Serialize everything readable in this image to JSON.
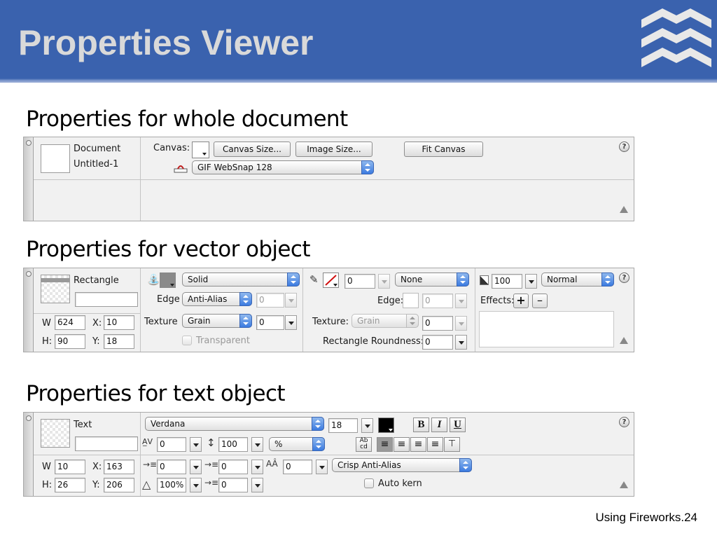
{
  "header": {
    "title": "Properties Viewer"
  },
  "sections": {
    "document": "Properties for whole document",
    "vector": "Properties for vector object",
    "text": "Properties for text object"
  },
  "doc_panel": {
    "type_label": "Document",
    "name": "Untitled-1",
    "canvas_label": "Canvas:",
    "canvas_size_btn": "Canvas Size...",
    "image_size_btn": "Image Size...",
    "fit_canvas_btn": "Fit Canvas",
    "export_format": "GIF WebSnap 128"
  },
  "vector_panel": {
    "type_label": "Rectangle",
    "name_value": "",
    "w_label": "W",
    "w_value": "624",
    "h_label": "H:",
    "h_value": "90",
    "x_label": "X:",
    "x_value": "10",
    "y_label": "Y:",
    "y_value": "18",
    "fill_type": "Solid",
    "edge_label": "Edge",
    "fill_edge": "Anti-Alias",
    "fill_edge_value": "0",
    "texture_label": "Texture",
    "fill_texture": "Grain",
    "fill_texture_value": "0",
    "transparent_label": "Transparent",
    "stroke_size": "0",
    "stroke_type": "None",
    "stroke_edge_label": "Edge:",
    "stroke_edge_value": "0",
    "stroke_texture_label": "Texture:",
    "stroke_texture": "Grain",
    "stroke_texture_value": "0",
    "roundness_label": "Rectangle Roundness:",
    "roundness_value": "0",
    "opacity_value": "100",
    "blend_mode": "Normal",
    "effects_label": "Effects:"
  },
  "text_panel": {
    "type_label": "Text",
    "name_value": "",
    "font": "Verdana",
    "size": "18",
    "bold": "B",
    "italic": "I",
    "underline": "U",
    "kerning_value": "0",
    "leading_value": "100",
    "leading_unit": "%",
    "w_label": "W",
    "w_value": "10",
    "h_label": "H:",
    "h_value": "26",
    "x_label": "X:",
    "x_value": "163",
    "y_label": "Y:",
    "y_value": "206",
    "indent_value": "0",
    "space_before_value": "0",
    "baseline_value": "0",
    "antialias": "Crisp Anti-Alias",
    "horiz_scale_value": "100%",
    "space_after_value": "0",
    "auto_kern_label": "Auto kern"
  },
  "footer": {
    "text": "Using Fireworks.24"
  },
  "colors": {
    "header_bg": "#3a62ae",
    "title_text": "#d9d9d9"
  }
}
